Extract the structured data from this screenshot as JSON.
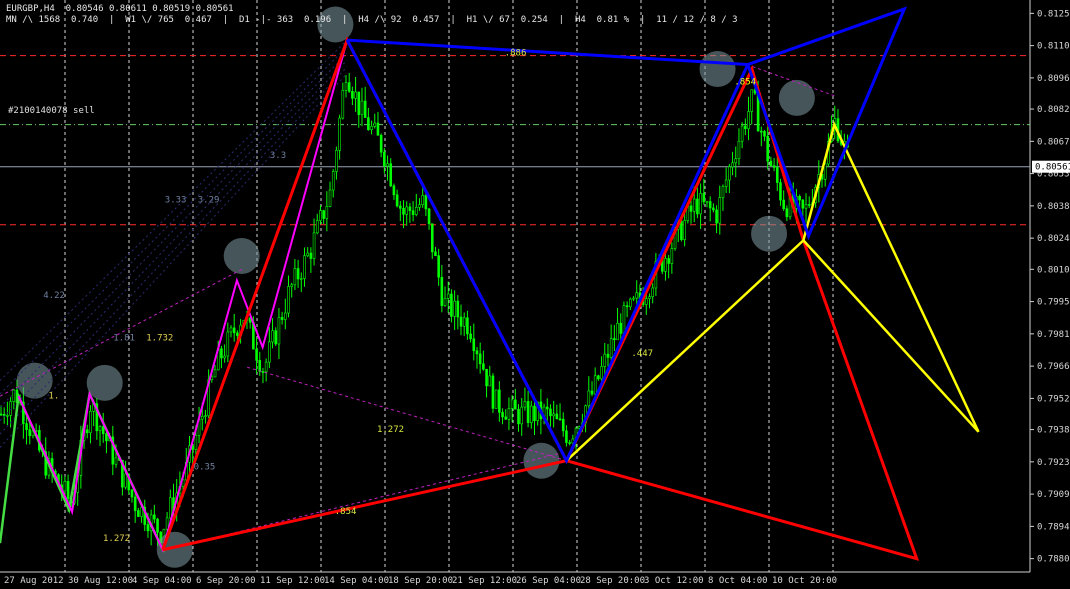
{
  "header": {
    "symbol_line": "EURGBP,H4  0.80546 0.80611 0.80519 0.80561",
    "stats_line": "MN /\\ 1568  0.740  |  W1 \\/ 765  0.467  |  D1 -|- 363  0.196  |  H4 /\\ 92  0.457  |  H1 \\/ 67  0.254  |  H4  0.81 %  |  11 / 12 / 8 / 3"
  },
  "order_label": "#2100140078 sell",
  "current_price_label": "0.80561",
  "colors": {
    "background": "#000000",
    "candle": "#00ff00",
    "grid": "#ffffff",
    "red": "#ff0000",
    "blue": "#0000ff",
    "yellow": "#ffff00",
    "magenta": "#ff00ff",
    "green": "#44dd44",
    "price_line": "#9aa3b8",
    "level_red": "#ff2a2a",
    "level_green": "#66cc66"
  },
  "chart_data": {
    "type": "candlestick",
    "symbol": "EURGBP",
    "timeframe": "H4",
    "ylim": [
      0.7874,
      0.8131
    ],
    "x_ticks": [
      "27 Aug 2012",
      "30 Aug 12:00",
      "4 Sep 04:00",
      "6 Sep 20:00",
      "11 Sep 12:00",
      "14 Sep 04:00",
      "18 Sep 20:00",
      "21 Sep 12:00",
      "26 Sep 04:00",
      "28 Sep 20:00",
      "3 Oct 12:00",
      "8 Oct 04:00",
      "10 Oct 20:00"
    ],
    "y_ticks": [
      "0.81250",
      "0.81105",
      "0.80960",
      "0.80820",
      "0.80675",
      "0.80530",
      "0.80385",
      "0.80240",
      "0.80100",
      "0.79955",
      "0.79810",
      "0.79665",
      "0.79520",
      "0.79380",
      "0.79235",
      "0.79090",
      "0.78945",
      "0.78800"
    ],
    "current_price": 0.80561,
    "hlines": [
      {
        "y": 0.8106,
        "style": "red-dash"
      },
      {
        "y": 0.8075,
        "style": "green-dashdot"
      },
      {
        "y": 0.803,
        "style": "red-dash"
      }
    ],
    "price_path": [
      {
        "t": 0,
        "p": 0.7945
      },
      {
        "t": 0.014,
        "p": 0.7955
      },
      {
        "t": 0.04,
        "p": 0.7925
      },
      {
        "t": 0.068,
        "p": 0.7905
      },
      {
        "t": 0.087,
        "p": 0.795
      },
      {
        "t": 0.11,
        "p": 0.7925
      },
      {
        "t": 0.13,
        "p": 0.7905
      },
      {
        "t": 0.155,
        "p": 0.7892
      },
      {
        "t": 0.18,
        "p": 0.792
      },
      {
        "t": 0.21,
        "p": 0.7968
      },
      {
        "t": 0.235,
        "p": 0.799
      },
      {
        "t": 0.255,
        "p": 0.7965
      },
      {
        "t": 0.28,
        "p": 0.8
      },
      {
        "t": 0.3,
        "p": 0.8018
      },
      {
        "t": 0.32,
        "p": 0.8045
      },
      {
        "t": 0.335,
        "p": 0.81
      },
      {
        "t": 0.35,
        "p": 0.808
      },
      {
        "t": 0.37,
        "p": 0.8065
      },
      {
        "t": 0.39,
        "p": 0.8035
      },
      {
        "t": 0.41,
        "p": 0.804
      },
      {
        "t": 0.43,
        "p": 0.7995
      },
      {
        "t": 0.455,
        "p": 0.7985
      },
      {
        "t": 0.48,
        "p": 0.795
      },
      {
        "t": 0.5,
        "p": 0.7945
      },
      {
        "t": 0.53,
        "p": 0.7945
      },
      {
        "t": 0.552,
        "p": 0.7935
      },
      {
        "t": 0.575,
        "p": 0.7955
      },
      {
        "t": 0.6,
        "p": 0.7985
      },
      {
        "t": 0.625,
        "p": 0.8
      },
      {
        "t": 0.65,
        "p": 0.802
      },
      {
        "t": 0.675,
        "p": 0.804
      },
      {
        "t": 0.695,
        "p": 0.8035
      },
      {
        "t": 0.71,
        "p": 0.806
      },
      {
        "t": 0.73,
        "p": 0.8087
      },
      {
        "t": 0.745,
        "p": 0.806
      },
      {
        "t": 0.76,
        "p": 0.804
      },
      {
        "t": 0.78,
        "p": 0.8035
      },
      {
        "t": 0.8,
        "p": 0.806
      },
      {
        "t": 0.81,
        "p": 0.8077
      },
      {
        "t": 0.825,
        "p": 0.8056
      }
    ],
    "patterns": [
      {
        "color": "red",
        "points": [
          [
            0.158,
            0.7884
          ],
          [
            0.337,
            0.8113
          ],
          [
            0.55,
            0.7924
          ],
          [
            0.73,
            0.81
          ],
          [
            0.78,
            0.8023
          ],
          [
            0.89,
            0.788
          ],
          [
            0.55,
            0.7924
          ],
          [
            0.158,
            0.7884
          ]
        ]
      },
      {
        "color": "blue",
        "points": [
          [
            0.337,
            0.8113
          ],
          [
            0.55,
            0.7924
          ],
          [
            0.726,
            0.8102
          ],
          [
            0.878,
            0.8127
          ],
          [
            0.785,
            0.8025
          ],
          [
            0.726,
            0.8102
          ],
          [
            0.337,
            0.8113
          ]
        ]
      },
      {
        "color": "yellow",
        "points": [
          [
            0.55,
            0.7924
          ],
          [
            0.78,
            0.8023
          ],
          [
            0.81,
            0.8075
          ],
          [
            0.95,
            0.7937
          ],
          [
            0.78,
            0.8023
          ]
        ]
      },
      {
        "color": "magenta",
        "points": [
          [
            0.018,
            0.7953
          ],
          [
            0.07,
            0.7901
          ],
          [
            0.087,
            0.7954
          ],
          [
            0.158,
            0.7884
          ],
          [
            0.23,
            0.8005
          ],
          [
            0.255,
            0.7975
          ],
          [
            0.337,
            0.8113
          ]
        ]
      },
      {
        "color": "green",
        "points": [
          [
            0.0,
            0.7887
          ],
          [
            0.018,
            0.7953
          ],
          [
            0.067,
            0.7902
          ],
          [
            0.087,
            0.7954
          ],
          [
            0.158,
            0.7884
          ]
        ]
      }
    ],
    "dashed_links": [
      [
        [
          0.24,
          0.7966
        ],
        [
          0.55,
          0.7924
        ]
      ],
      [
        [
          0.16,
          0.7884
        ],
        [
          0.55,
          0.7928
        ]
      ],
      [
        [
          0.725,
          0.8102
        ],
        [
          0.81,
          0.8088
        ]
      ],
      [
        [
          0.0,
          0.7953
        ],
        [
          0.235,
          0.801
        ]
      ]
    ],
    "pivots": [
      [
        0.022,
        0.796
      ],
      [
        0.09,
        0.7959
      ],
      [
        0.158,
        0.7884
      ],
      [
        0.223,
        0.8016
      ],
      [
        0.314,
        0.812
      ],
      [
        0.514,
        0.7924
      ],
      [
        0.685,
        0.81
      ],
      [
        0.762,
        0.8087
      ],
      [
        0.735,
        0.8026
      ]
    ],
    "annotations": [
      {
        "text": ".886",
        "x": 0.49,
        "p": 0.8106,
        "color": "#d8e840"
      },
      {
        "text": ".854",
        "x": 0.713,
        "p": 0.8093,
        "color": "#ffff00"
      },
      {
        "text": "3.3",
        "x": 0.262,
        "p": 0.806,
        "color": "#7080a0"
      },
      {
        "text": "3.33",
        "x": 0.16,
        "p": 0.804,
        "color": "#7080a0"
      },
      {
        "text": "3.29",
        "x": 0.192,
        "p": 0.804,
        "color": "#7080a0"
      },
      {
        "text": "4.22",
        "x": 0.042,
        "p": 0.7997,
        "color": "#7080a0"
      },
      {
        "text": "1.81",
        "x": 0.11,
        "p": 0.7978,
        "color": "#7080a0"
      },
      {
        "text": "1.732",
        "x": 0.142,
        "p": 0.7978,
        "color": "#e0d050"
      },
      {
        "text": "1.",
        "x": 0.047,
        "p": 0.7952,
        "color": "#e0d050"
      },
      {
        "text": "1.272",
        "x": 0.366,
        "p": 0.7937,
        "color": "#d8e840"
      },
      {
        "text": ".447",
        "x": 0.613,
        "p": 0.7971,
        "color": "#d8e840"
      },
      {
        "text": "0.35",
        "x": 0.188,
        "p": 0.792,
        "color": "#7080a0"
      },
      {
        "text": ".854",
        "x": 0.325,
        "p": 0.79,
        "color": "#d8e840"
      },
      {
        "text": "1.272",
        "x": 0.1,
        "p": 0.7888,
        "color": "#e0d050"
      }
    ]
  }
}
